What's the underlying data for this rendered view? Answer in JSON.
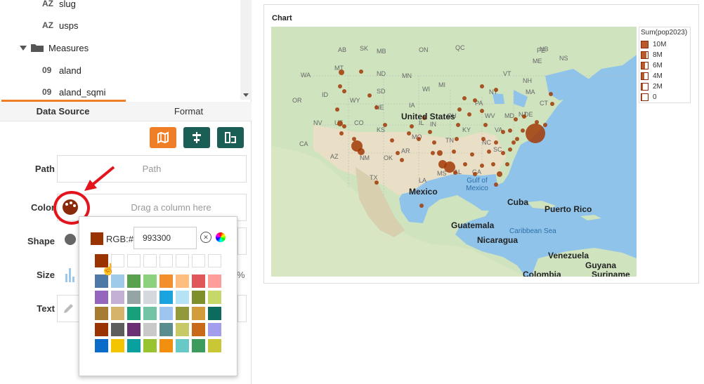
{
  "fields_tree": {
    "items": [
      {
        "icon": "AZ",
        "label": "slug"
      },
      {
        "icon": "AZ",
        "label": "usps"
      },
      {
        "icon": "folder",
        "label": "Measures"
      },
      {
        "icon": "09",
        "label": "aland"
      },
      {
        "icon": "09",
        "label": "aland_sqmi"
      }
    ]
  },
  "tabs": {
    "data_source": "Data Source",
    "format": "Format"
  },
  "sections": {
    "path_label": "Path",
    "path_placeholder": "Path",
    "color_label": "Color",
    "color_placeholder": "Drag a column here",
    "shape_label": "Shape",
    "size_label": "Size",
    "text_label": "Text"
  },
  "color_picker": {
    "rgb_label": "RGB:#",
    "rgb_value": "993300",
    "current_color": "#993300",
    "swatches": [
      [
        "#993300",
        "",
        "",
        "",
        "",
        "",
        "",
        ""
      ],
      [
        "#4e79a7",
        "#a0cbe8",
        "#59a14f",
        "#8cd17d",
        "#f28e2b",
        "#ffbe7d",
        "#e15759",
        "#ff9d9a"
      ],
      [
        "#9467bd",
        "#c5b0d5",
        "#95a5a6",
        "#d3d9de",
        "#1ba3e0",
        "#b3e3f4",
        "#7f8f2b",
        "#c7d86a"
      ],
      [
        "#a67c32",
        "#d3b46a",
        "#17a07a",
        "#73c3a6",
        "#9ec5f0",
        "#92993a",
        "#d29c3a",
        "#0c6b5c"
      ],
      [
        "#993300",
        "#5d5d5d",
        "#6b2f73",
        "#c9c9c9",
        "#5a8d8d",
        "#c7c967",
        "#c96a1b",
        "#a39dee"
      ],
      [
        "#0b6bc9",
        "#f2c500",
        "#0aa0a0",
        "#99c431",
        "#f28f0e",
        "#67c8c6",
        "#3c9b5d",
        "#c9c736"
      ]
    ]
  },
  "chart": {
    "title": "Chart",
    "legend": {
      "title": "Sum(pop2023)",
      "items": [
        {
          "label": "10M",
          "level": 1.0
        },
        {
          "label": "8M",
          "level": 0.8
        },
        {
          "label": "6M",
          "level": 0.6
        },
        {
          "label": "4M",
          "level": 0.4
        },
        {
          "label": "2M",
          "level": 0.2
        },
        {
          "label": "0",
          "level": 0.0
        }
      ]
    },
    "map_labels": {
      "us": "United States",
      "mexico": "Mexico",
      "gulf": "Gulf of\nMexico",
      "cuba": "Cuba",
      "pr": "Puerto Rico",
      "guatemala": "Guatemala",
      "nicaragua": "Nicaragua",
      "caribbean": "Caribbean Sea",
      "venezuela": "Venezuela",
      "guyana": "Guyana",
      "colombia": "Colombia",
      "suriname": "Suriname",
      "provinces": [
        "AB",
        "SK",
        "MB",
        "ON",
        "QC",
        "NB",
        "NS",
        "PE",
        "MT",
        "ND",
        "MN",
        "WA",
        "OR",
        "ID",
        "WY",
        "SD",
        "WI",
        "MI",
        "NE",
        "IA",
        "NV",
        "UT",
        "CO",
        "KS",
        "IL",
        "IN",
        "OH",
        "PA",
        "NY",
        "ME",
        "VT",
        "NH",
        "MA",
        "CT",
        "NJ",
        "MD",
        "WV",
        "VA",
        "DE",
        "KY",
        "MO",
        "TN",
        "NC",
        "SC",
        "AR",
        "OK",
        "TX",
        "LA",
        "MS",
        "AL",
        "GA",
        "CA",
        "AZ",
        "NM"
      ]
    },
    "bubble_color": "#a23a06"
  }
}
